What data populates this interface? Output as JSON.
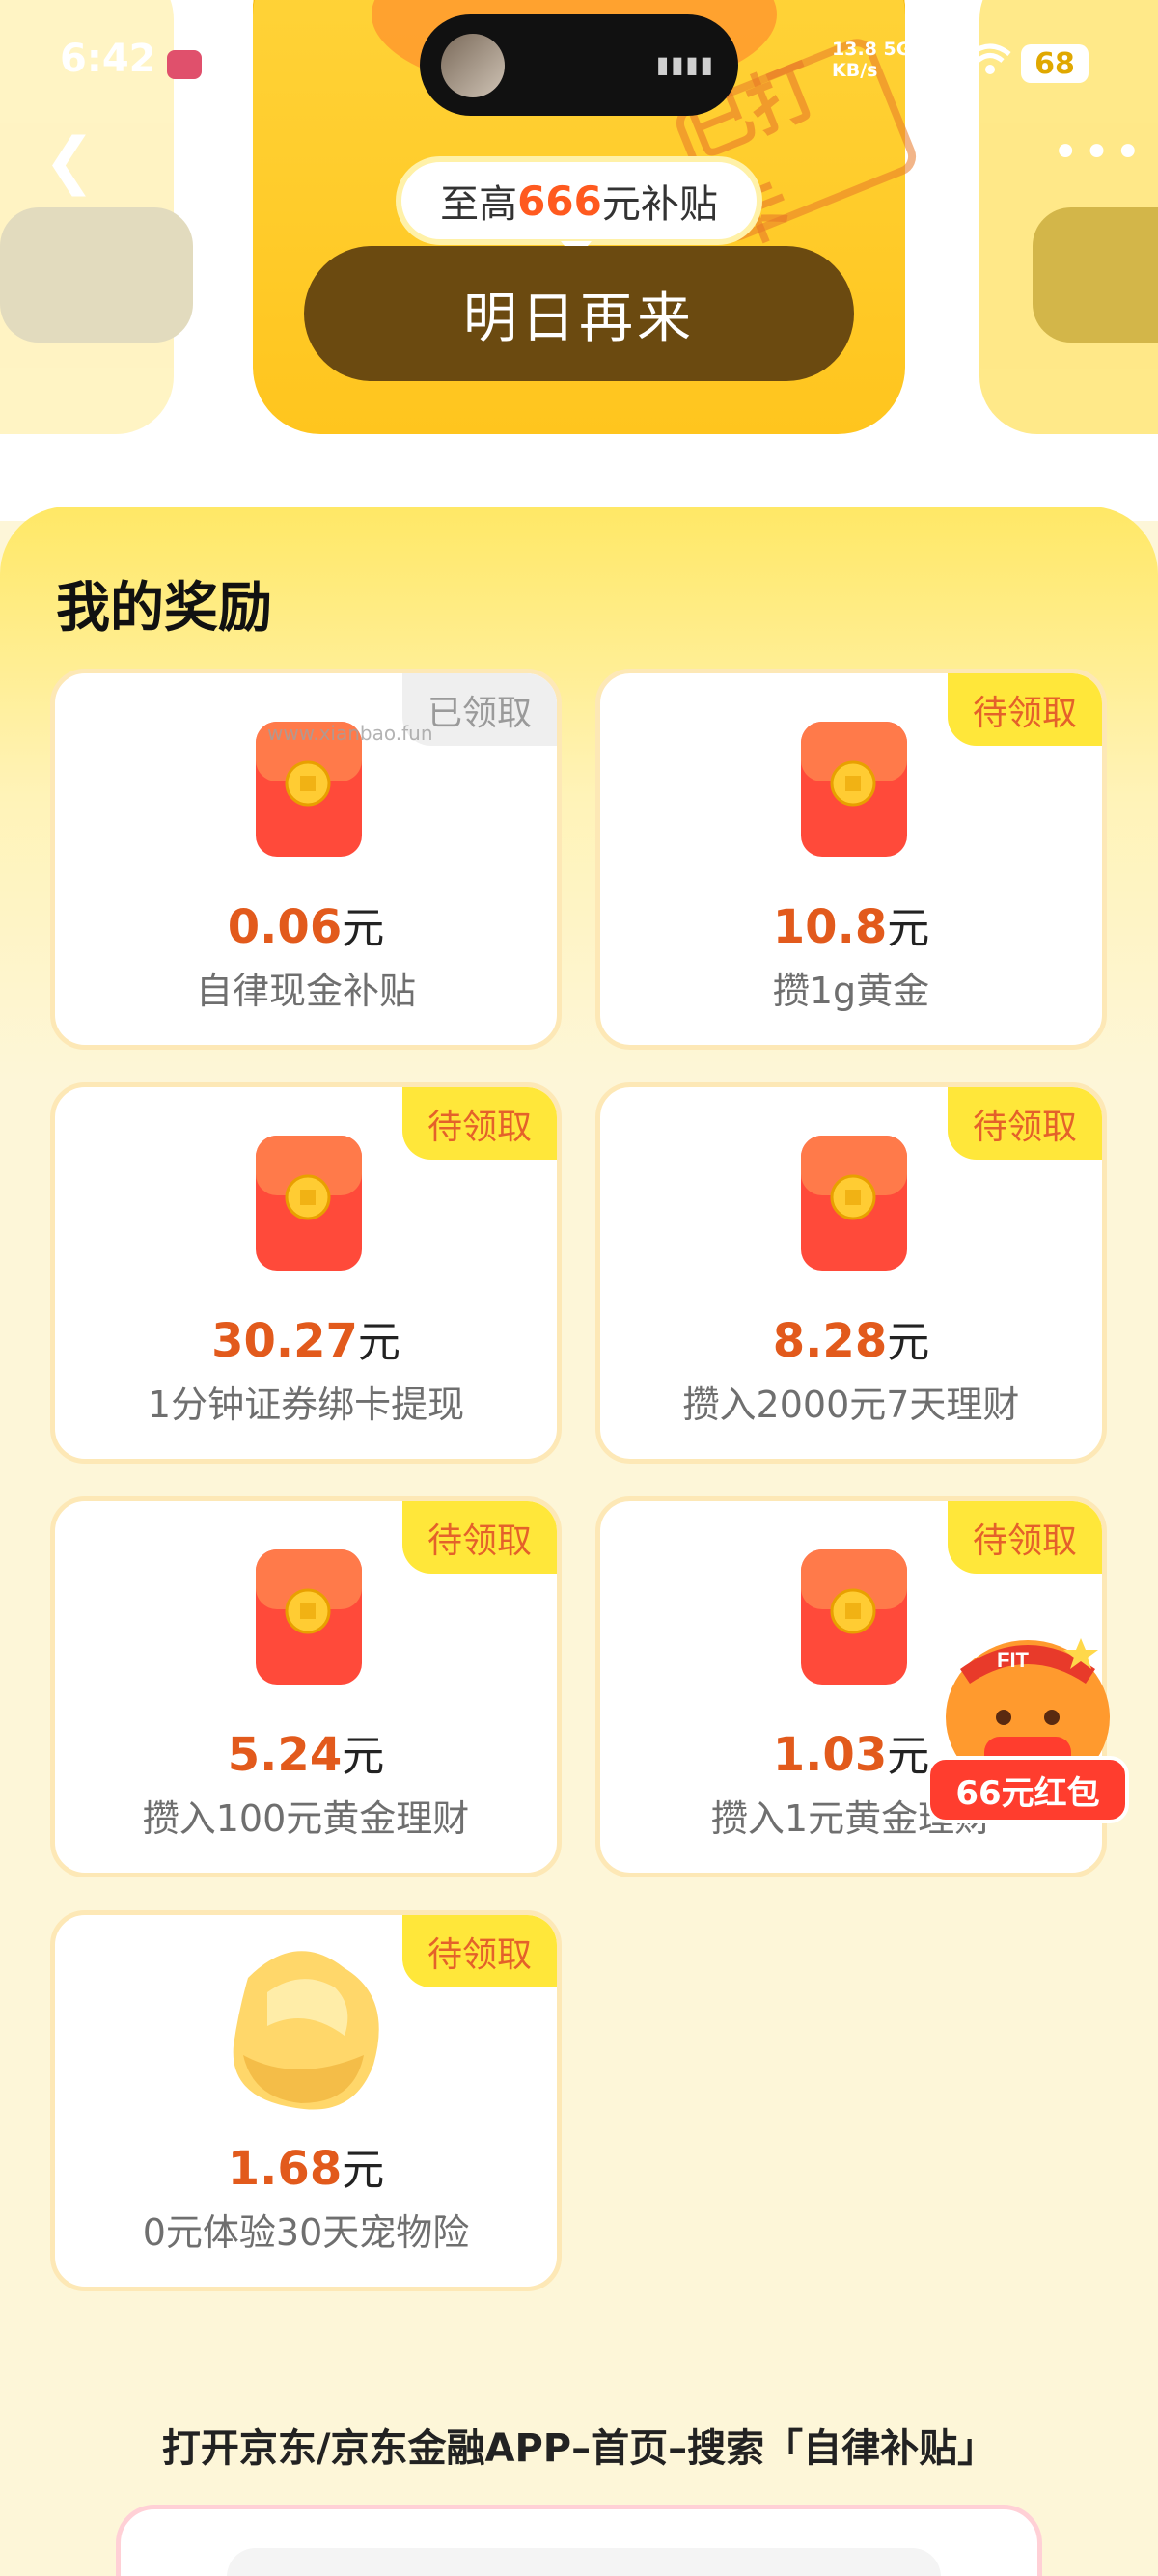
{
  "status_bar": {
    "time": "6:42",
    "network_speed_value": "13.8",
    "network_speed_unit": "KB/s",
    "network_type": "5G",
    "battery": "68"
  },
  "top_card": {
    "subsidy_prefix": "至高",
    "subsidy_amount": "666",
    "subsidy_suffix": "元补贴",
    "button_label": "明日再来",
    "stamp_text": "已打卡"
  },
  "rewards": {
    "title": "我的奖励",
    "currency": "元",
    "items": [
      {
        "amount": "0.06",
        "name": "自律现金补贴",
        "status": "已领取"
      },
      {
        "amount": "10.8",
        "name": "攒1g黄金",
        "status": "待领取"
      },
      {
        "amount": "30.27",
        "name": "1分钟证券绑卡提现",
        "status": "待领取"
      },
      {
        "amount": "8.28",
        "name": "攒入2000元7天理财",
        "status": "待领取"
      },
      {
        "amount": "5.24",
        "name": "攒入100元黄金理财",
        "status": "待领取"
      },
      {
        "amount": "1.03",
        "name": "攒入1元黄金理财",
        "status": "待领取"
      },
      {
        "amount": "1.68",
        "name": "0元体验30天宠物险",
        "status": "待领取"
      }
    ],
    "watermark": "www.xianbao.fun"
  },
  "floating": {
    "badge_label": "66元红包",
    "hat_text": "FIT"
  },
  "instruction": "打开京东/京东金融APP–首页–搜索「自律补贴」",
  "colors": {
    "accent": "#e25a1c",
    "tag_bg": "#ffe73a",
    "button_bg": "#6b4a10"
  }
}
